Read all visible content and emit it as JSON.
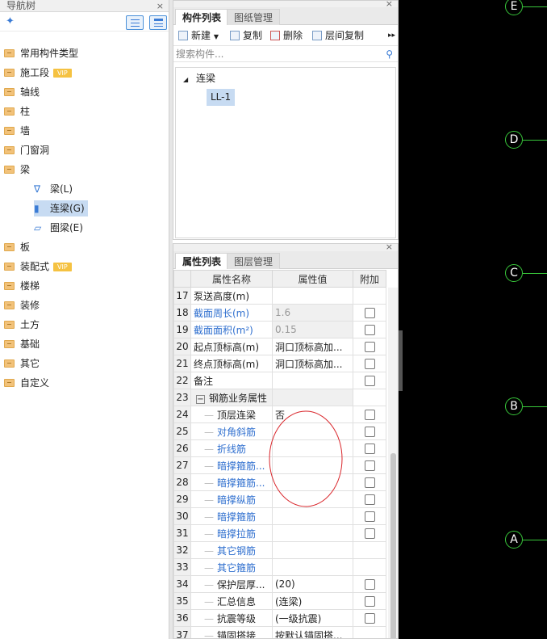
{
  "nav": {
    "title": "导航树",
    "items": [
      {
        "label": "常用构件类型"
      },
      {
        "label": "施工段",
        "badge": "VIP"
      },
      {
        "label": "轴线"
      },
      {
        "label": "柱"
      },
      {
        "label": "墙"
      },
      {
        "label": "门窗洞"
      },
      {
        "label": "梁"
      },
      {
        "label": "板"
      },
      {
        "label": "装配式",
        "badge": "VIP"
      },
      {
        "label": "楼梯"
      },
      {
        "label": "装修"
      },
      {
        "label": "土方"
      },
      {
        "label": "基础"
      },
      {
        "label": "其它"
      },
      {
        "label": "自定义"
      }
    ],
    "beam_children": [
      {
        "label": "梁(L)",
        "icon": "beam-icon"
      },
      {
        "label": "连梁(G)",
        "icon": "link-beam-icon"
      },
      {
        "label": "圈梁(E)",
        "icon": "ring-beam-icon"
      }
    ]
  },
  "component_panel": {
    "tabs": [
      "构件列表",
      "图纸管理"
    ],
    "toolbar": [
      "新建",
      "复制",
      "删除",
      "层间复制"
    ],
    "search_placeholder": "搜索构件...",
    "tree_root": "连梁",
    "tree_item": "LL-1"
  },
  "property_panel": {
    "tabs": [
      "属性列表",
      "图层管理"
    ],
    "columns": [
      "属性名称",
      "属性值",
      "附加"
    ],
    "rows": [
      {
        "num": "17",
        "name": "泵送高度(m)",
        "value": "",
        "check": false,
        "blue": false,
        "ro": false,
        "indent": false
      },
      {
        "num": "18",
        "name": "截面周长(m)",
        "value": "1.6",
        "check": true,
        "blue": true,
        "ro": true,
        "indent": false
      },
      {
        "num": "19",
        "name": "截面面积(m²)",
        "value": "0.15",
        "check": true,
        "blue": true,
        "ro": true,
        "indent": false
      },
      {
        "num": "20",
        "name": "起点顶标高(m)",
        "value": "洞口顶标高加...",
        "check": true,
        "blue": false,
        "ro": false,
        "indent": false
      },
      {
        "num": "21",
        "name": "终点顶标高(m)",
        "value": "洞口顶标高加...",
        "check": true,
        "blue": false,
        "ro": false,
        "indent": false
      },
      {
        "num": "22",
        "name": "备注",
        "value": "",
        "check": true,
        "blue": false,
        "ro": false,
        "indent": false
      },
      {
        "num": "23",
        "name": "钢筋业务属性",
        "value": "",
        "check": false,
        "blue": false,
        "ro": false,
        "indent": false,
        "group": true
      },
      {
        "num": "24",
        "name": "顶层连梁",
        "value": "否",
        "check": true,
        "blue": false,
        "ro": false,
        "indent": true
      },
      {
        "num": "25",
        "name": "对角斜筋",
        "value": "",
        "check": true,
        "blue": true,
        "ro": false,
        "indent": true
      },
      {
        "num": "26",
        "name": "折线筋",
        "value": "",
        "check": true,
        "blue": true,
        "ro": false,
        "indent": true
      },
      {
        "num": "27",
        "name": "暗撑箍筋...",
        "value": "",
        "check": true,
        "blue": true,
        "ro": false,
        "indent": true
      },
      {
        "num": "28",
        "name": "暗撑箍筋...",
        "value": "",
        "check": true,
        "blue": true,
        "ro": false,
        "indent": true
      },
      {
        "num": "29",
        "name": "暗撑纵筋",
        "value": "",
        "check": true,
        "blue": true,
        "ro": false,
        "indent": true
      },
      {
        "num": "30",
        "name": "暗撑箍筋",
        "value": "",
        "check": true,
        "blue": true,
        "ro": false,
        "indent": true
      },
      {
        "num": "31",
        "name": "暗撑拉筋",
        "value": "",
        "check": true,
        "blue": true,
        "ro": false,
        "indent": true
      },
      {
        "num": "32",
        "name": "其它钢筋",
        "value": "",
        "check": false,
        "blue": true,
        "ro": false,
        "indent": true
      },
      {
        "num": "33",
        "name": "其它箍筋",
        "value": "",
        "check": false,
        "blue": true,
        "ro": false,
        "indent": true
      },
      {
        "num": "34",
        "name": "保护层厚...",
        "value": "(20)",
        "check": true,
        "blue": false,
        "ro": false,
        "indent": true
      },
      {
        "num": "35",
        "name": "汇总信息",
        "value": "(连梁)",
        "check": true,
        "blue": false,
        "ro": false,
        "indent": true
      },
      {
        "num": "36",
        "name": "抗震等级",
        "value": "(一级抗震)",
        "check": true,
        "blue": false,
        "ro": false,
        "indent": true
      },
      {
        "num": "37",
        "name": "锚固搭接",
        "value": "按默认锚固搭...",
        "check": false,
        "blue": false,
        "ro": false,
        "indent": true
      }
    ]
  },
  "canvas": {
    "axes": [
      "E",
      "D",
      "C",
      "B",
      "A"
    ],
    "axis_color": "#38c63a",
    "annotation_color": "#d9262b"
  }
}
